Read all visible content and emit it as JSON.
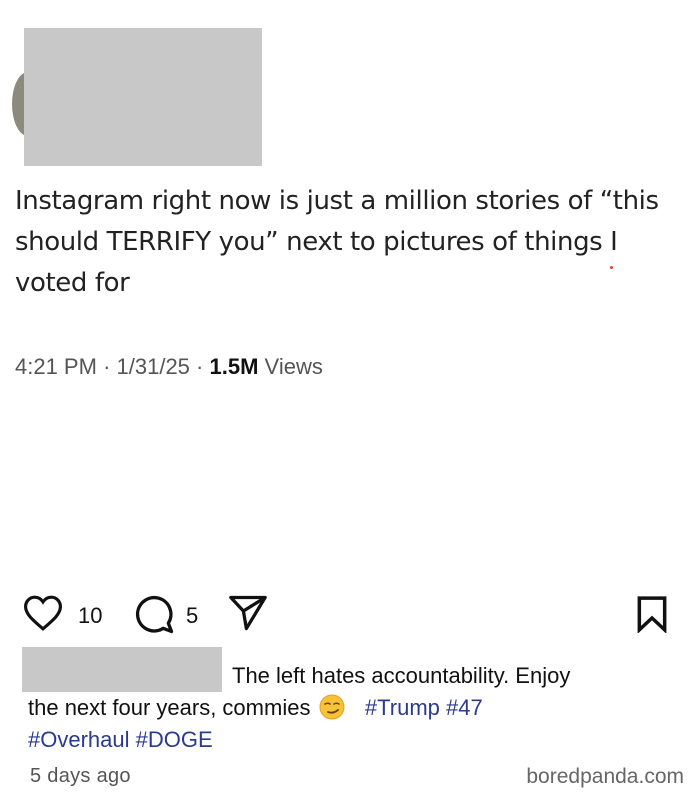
{
  "tweet": {
    "text": "Instagram right now is just a million stories of “this should TERRIFY you” next to pictures of things I voted for",
    "time": "4:21 PM",
    "date": "1/31/25",
    "views_count": "1.5M",
    "views_label": "Views"
  },
  "post": {
    "likes": "10",
    "comments": "5",
    "caption_line1": "The left hates accountability. Enjoy",
    "caption_line2": "the next four years, commies",
    "hashtags": [
      "#Trump",
      "#47",
      "#Overhaul",
      "#DOGE"
    ],
    "time_ago": "5 days ago"
  },
  "watermark": "boredpanda.com",
  "icons": {
    "like": "heart-icon",
    "comment": "comment-bubble-icon",
    "share": "paper-plane-icon",
    "save": "bookmark-icon",
    "emoji": "smirking-face-emoji"
  },
  "colors": {
    "hashtag": "#2b3a8f",
    "redaction": "#c8c8c8",
    "meta_text": "#555555"
  }
}
